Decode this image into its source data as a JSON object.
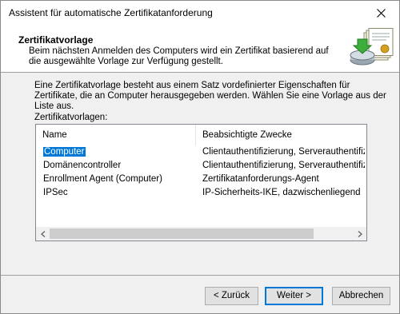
{
  "window": {
    "title": "Assistent für automatische Zertifikatanforderung"
  },
  "header": {
    "title": "Zertifikatvorlage",
    "subtitle": "Beim nächsten Anmelden des Computers wird ein Zertifikat basierend auf die ausgewählte Vorlage zur Verfügung gestellt.",
    "icon": "certificate-install-icon"
  },
  "main": {
    "intro": "Eine Zertifikatvorlage besteht aus einem Satz vordefinierter Eigenschaften für Zertifikate, die an Computer herausgegeben werden. Wählen Sie eine Vorlage aus der Liste aus.",
    "list_label": "Zertifikatvorlagen:",
    "columns": [
      "Name",
      "Beabsichtigte Zwecke"
    ],
    "rows": [
      {
        "name": "Computer",
        "purpose": "Clientauthentifizierung, Serverauthentifizier...",
        "selected": true
      },
      {
        "name": "Domänencontroller",
        "purpose": "Clientauthentifizierung, Serverauthentifizier...",
        "selected": false
      },
      {
        "name": "Enrollment Agent (Computer)",
        "purpose": "Zertifikatanforderungs-Agent",
        "selected": false
      },
      {
        "name": "IPSec",
        "purpose": "IP-Sicherheits-IKE, dazwischenliegend",
        "selected": false
      }
    ]
  },
  "buttons": {
    "back": "< Zurück",
    "next": "Weiter >",
    "cancel": "Abbrechen"
  },
  "colors": {
    "selection": "#0078d7",
    "default_button_border": "#0078d7"
  }
}
